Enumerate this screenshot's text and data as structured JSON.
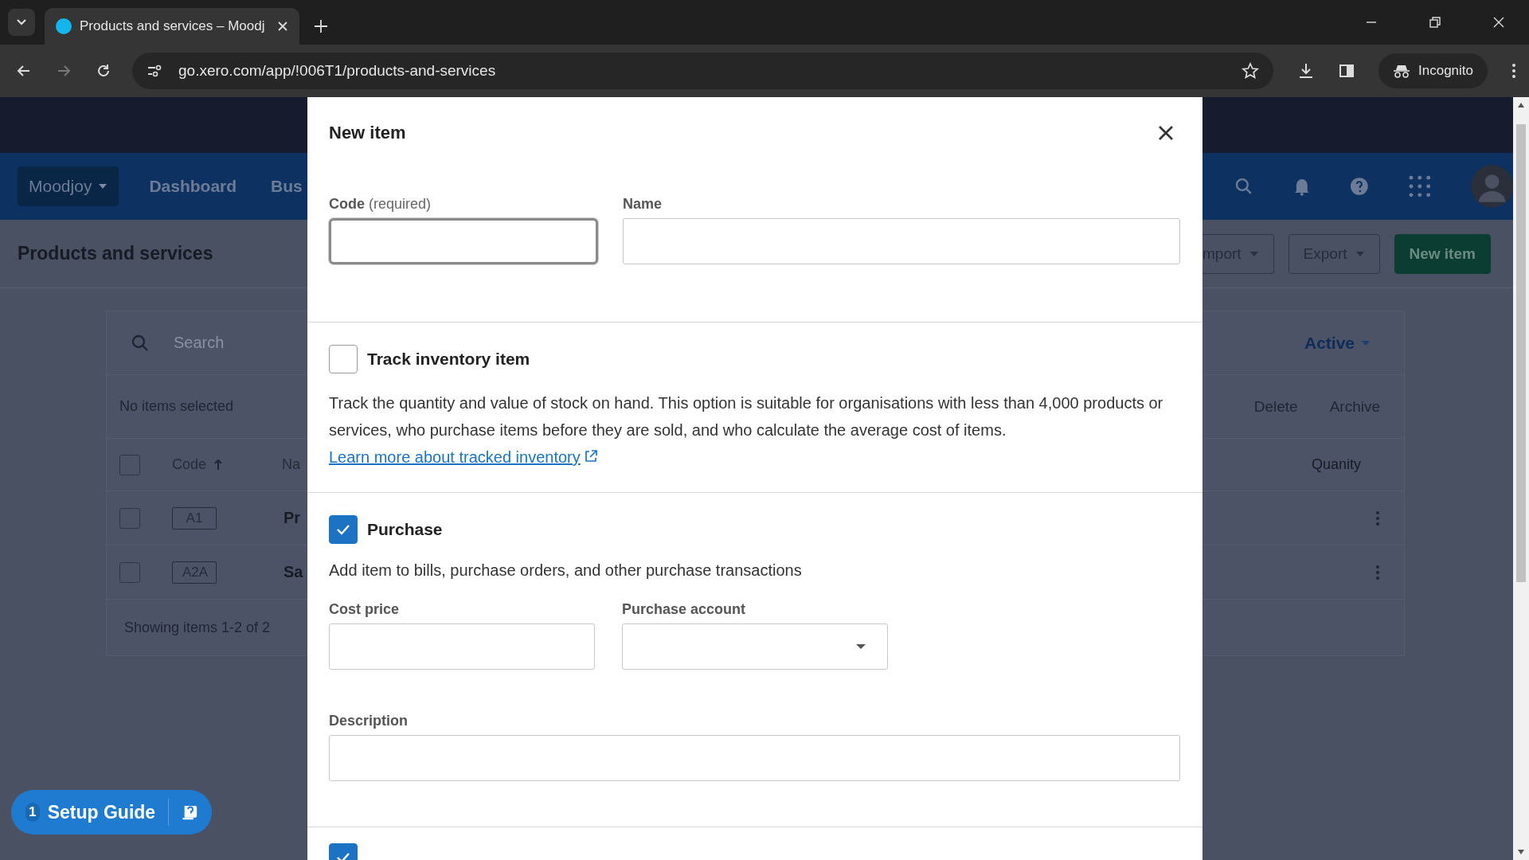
{
  "browser": {
    "tab_title": "Products and services – Moodj",
    "url": "go.xero.com/app/!006T1/products-and-services",
    "profile_label": "Incognito"
  },
  "app": {
    "org_menu": "Moodjoy",
    "nav": [
      "Dashboard",
      "Bus"
    ],
    "page_title": "Products and services",
    "header_buttons": [
      {
        "label": "mport",
        "kind": "dropdown"
      },
      {
        "label": "Export",
        "kind": "dropdown"
      },
      {
        "label": "New item",
        "kind": "primary"
      }
    ],
    "search_placeholder": "Search",
    "filter": "Active",
    "selection_text": "No items selected",
    "bulk_actions": [
      "Delete",
      "Archive"
    ],
    "select_all_checked": false,
    "columns": [
      {
        "label": "Code",
        "sorted": true
      },
      {
        "label": "Na",
        "sorted": false
      },
      {
        "label": "Quanity",
        "sorted": false
      }
    ],
    "rows": [
      {
        "code": "A1",
        "name": "Pr",
        "checked": false
      },
      {
        "code": "A2A",
        "name": "Sa",
        "checked": false
      }
    ],
    "footer": "Showing items 1-2 of 2"
  },
  "setup_guide": {
    "count": "1",
    "label": "Setup Guide"
  },
  "dialog": {
    "title": "New item",
    "code_field": {
      "label": "Code",
      "note": "(required)",
      "focused": true
    },
    "name_field": {
      "label": "Name",
      "focused": false
    },
    "track_inventory": {
      "label": "Track inventory item",
      "checked": false,
      "description": "Track the quantity and value of stock on hand. This option is suitable for organisations with less than 4,000 products or services, who purchase items before they are sold, and who calculate the average cost of items.",
      "link": "Learn more about tracked inventory"
    },
    "purchase": {
      "label": "Purchase",
      "checked": true,
      "description": "Add item to bills, purchase orders, and other purchase transactions",
      "cost_price_label": "Cost price",
      "account_label": "Purchase account",
      "description_label": "Description"
    },
    "sell": {
      "checked": true
    }
  }
}
